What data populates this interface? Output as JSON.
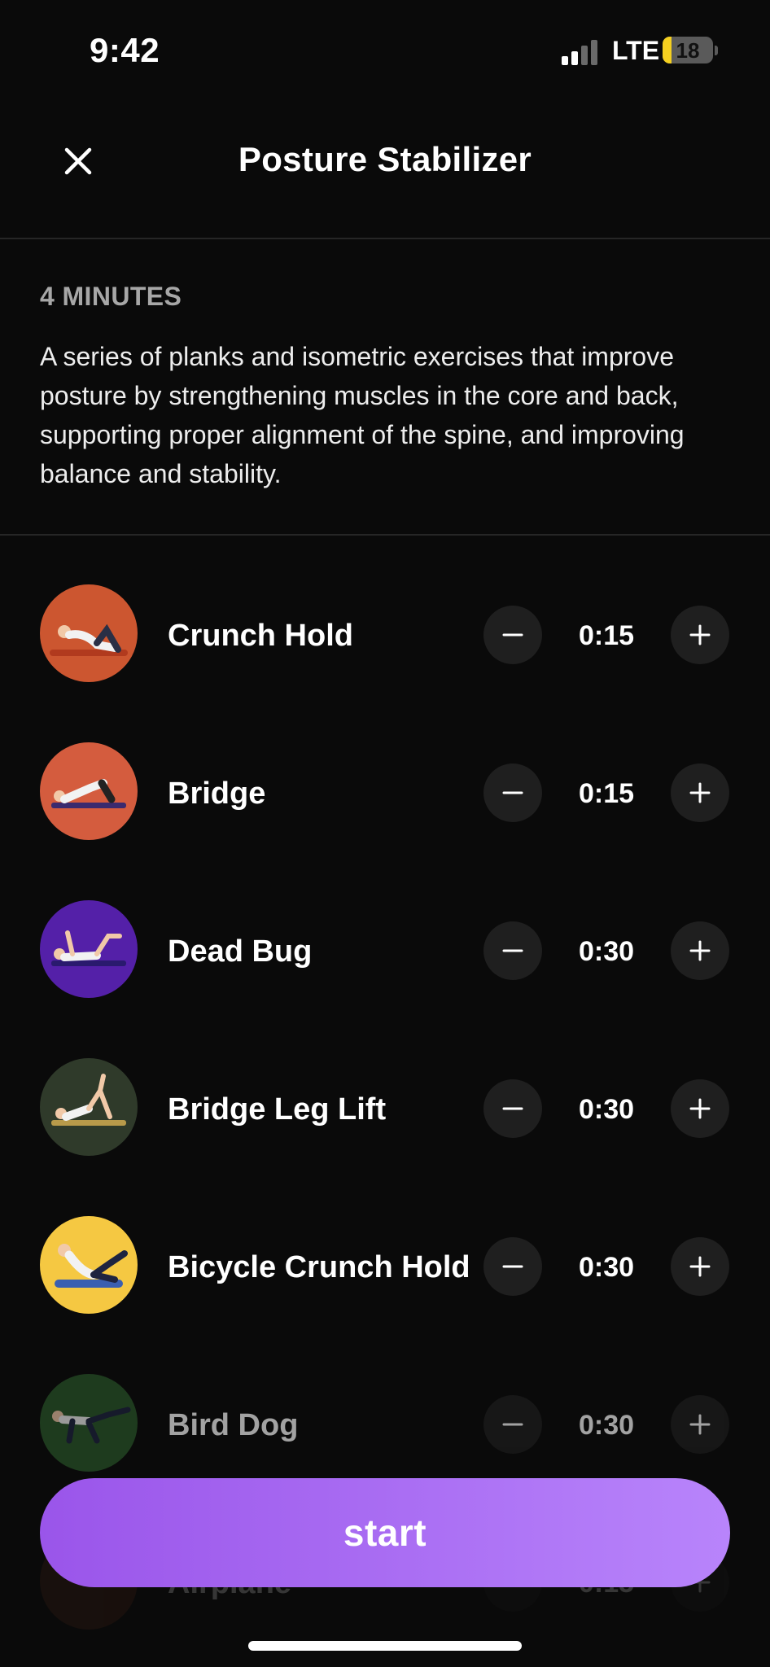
{
  "status_bar": {
    "time": "9:42",
    "network": "LTE",
    "battery": "18",
    "battery_level": 0.18,
    "colors": {
      "battery_fill": "#f5d020"
    }
  },
  "header": {
    "close_icon": "close-icon",
    "title": "Posture Stabilizer"
  },
  "workout": {
    "duration": "4 MINUTES",
    "description": "A series of planks and isometric exercises that improve posture by strengthening muscles in the core and back, supporting proper alignment of the spine, and improving balance and stability."
  },
  "exercises": [
    {
      "name": "Crunch Hold",
      "time": "0:15",
      "thumb_color": "#cc5630"
    },
    {
      "name": "Bridge",
      "time": "0:15",
      "thumb_color": "#d45c3e"
    },
    {
      "name": "Dead Bug",
      "time": "0:30",
      "thumb_color": "#5420a8"
    },
    {
      "name": "Bridge Leg Lift",
      "time": "0:30",
      "thumb_color": "#2f3a2a"
    },
    {
      "name": "Bicycle Crunch Hold",
      "time": "0:30",
      "thumb_color": "#f5c842"
    },
    {
      "name": "Bird Dog",
      "time": "0:30",
      "thumb_color": "#2b5a2b"
    },
    {
      "name": "Airplane",
      "time": "0:15",
      "thumb_color": "#5a2a1a"
    }
  ],
  "controls": {
    "minus_icon": "minus-icon",
    "plus_icon": "plus-icon"
  },
  "start_button": {
    "label": "start",
    "gradient": [
      "#9a55ea",
      "#b884fb"
    ]
  }
}
